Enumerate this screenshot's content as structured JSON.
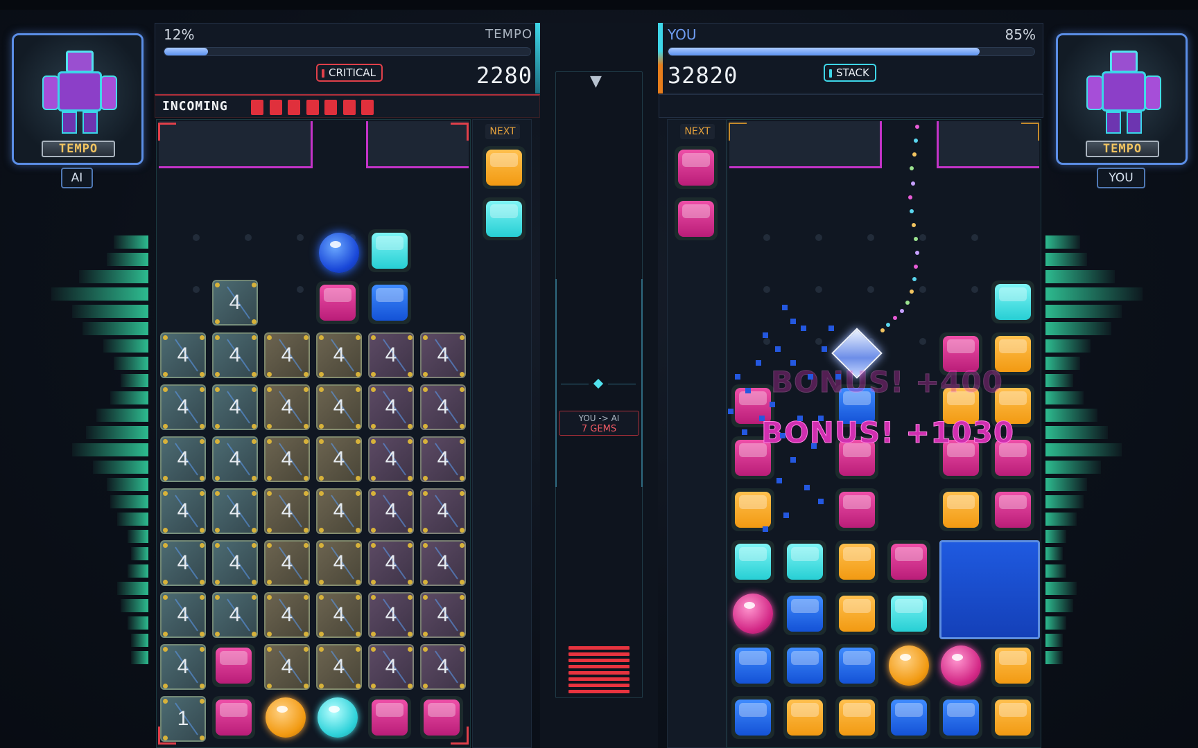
{
  "left_player": {
    "avatar_name": "TEMPO",
    "tag": "AI",
    "progress_percent_label": "12%",
    "progress_fraction": 0.12,
    "meter_label": "TEMPO",
    "score": "2280",
    "status_badge": "CRITICAL",
    "incoming_label": "INCOMING",
    "incoming_count": 7,
    "next_label": "NEXT",
    "next_pieces": [
      "orange",
      "cyan"
    ]
  },
  "right_player": {
    "avatar_name": "TEMPO",
    "tag": "YOU",
    "name_label": "YOU",
    "progress_percent_label": "85%",
    "progress_fraction": 0.85,
    "score": "32820",
    "status_badge": "STACK",
    "next_label": "NEXT",
    "next_pieces": [
      "magenta",
      "magenta"
    ]
  },
  "center": {
    "transfer_line1": "YOU -> AI",
    "transfer_line2": "7 GEMS",
    "drop_icon": "triangle-down-icon"
  },
  "bonus_popups": {
    "bonus_top": "BONUS! +400",
    "bonus_main": "BONUS! +1030"
  },
  "garbage_value": "4",
  "garbage_counter_value": "1",
  "colors": {
    "accent_magenta": "#c433c8",
    "critical_red": "#e0404a",
    "stack_cyan": "#3ed6e8",
    "eq_green": "#2dbb8f",
    "progress_blue": "#5d93f0"
  }
}
